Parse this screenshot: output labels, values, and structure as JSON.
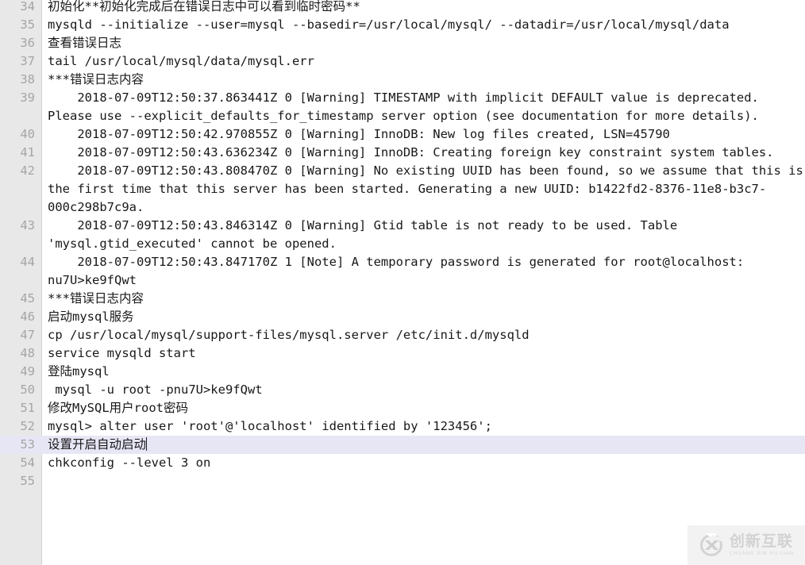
{
  "editor": {
    "first_visible_line": 34,
    "active_line": 53,
    "gutter_color": "#e8e8e8",
    "lineno_color": "#a5a5a5",
    "text_color": "#18181a",
    "background_color": "#ffffff",
    "active_line_highlight_color": "#e7e6f5"
  },
  "lines": [
    {
      "number": "34",
      "text": "初始化**初始化完成后在错误日志中可以看到临时密码**",
      "active": false
    },
    {
      "number": "35",
      "text": "mysqld --initialize --user=mysql --basedir=/usr/local/mysql/ --datadir=/usr/local/mysql/data",
      "active": false
    },
    {
      "number": "36",
      "text": "查看错误日志",
      "active": false
    },
    {
      "number": "37",
      "text": "tail /usr/local/mysql/data/mysql.err",
      "active": false
    },
    {
      "number": "38",
      "text": "***错误日志内容",
      "active": false
    },
    {
      "number": "39",
      "text": "    2018-07-09T12:50:37.863441Z 0 [Warning] TIMESTAMP with implicit DEFAULT value is deprecated. Please use --explicit_defaults_for_timestamp server option (see documentation for more details).",
      "active": false
    },
    {
      "number": "40",
      "text": "    2018-07-09T12:50:42.970855Z 0 [Warning] InnoDB: New log files created, LSN=45790",
      "active": false
    },
    {
      "number": "41",
      "text": "    2018-07-09T12:50:43.636234Z 0 [Warning] InnoDB: Creating foreign key constraint system tables.",
      "active": false
    },
    {
      "number": "42",
      "text": "    2018-07-09T12:50:43.808470Z 0 [Warning] No existing UUID has been found, so we assume that this is the first time that this server has been started. Generating a new UUID: b1422fd2-8376-11e8-b3c7-000c298b7c9a.",
      "active": false
    },
    {
      "number": "43",
      "text": "    2018-07-09T12:50:43.846314Z 0 [Warning] Gtid table is not ready to be used. Table 'mysql.gtid_executed' cannot be opened.",
      "active": false
    },
    {
      "number": "44",
      "text": "    2018-07-09T12:50:43.847170Z 1 [Note] A temporary password is generated for root@localhost: nu7U>ke9fQwt",
      "active": false
    },
    {
      "number": "45",
      "text": "***错误日志内容",
      "active": false
    },
    {
      "number": "46",
      "text": "启动mysql服务",
      "active": false
    },
    {
      "number": "47",
      "text": "cp /usr/local/mysql/support-files/mysql.server /etc/init.d/mysqld",
      "active": false
    },
    {
      "number": "48",
      "text": "service mysqld start",
      "active": false
    },
    {
      "number": "49",
      "text": "登陆mysql",
      "active": false
    },
    {
      "number": "50",
      "text": " mysql -u root -pnu7U>ke9fQwt",
      "active": false
    },
    {
      "number": "51",
      "text": "修改MySQL用户root密码",
      "active": false
    },
    {
      "number": "52",
      "text": "mysql> alter user 'root'@'localhost' identified by '123456';",
      "active": false
    },
    {
      "number": "53",
      "text": "设置开启自动启动",
      "active": true
    },
    {
      "number": "54",
      "text": "chkconfig --level 3 on",
      "active": false
    },
    {
      "number": "55",
      "text": "",
      "active": false
    }
  ],
  "watermark": {
    "icon": "circle-x-logo-icon",
    "brand_cn": "创新互联",
    "brand_en": "CHUANG XIN HU LIAN",
    "color": "#d2d2d2"
  }
}
